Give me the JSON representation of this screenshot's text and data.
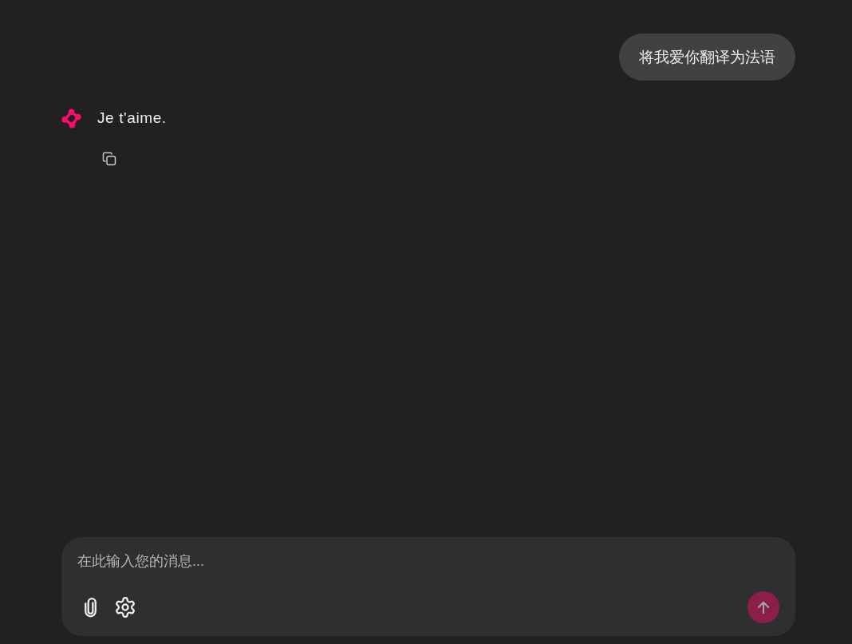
{
  "messages": [
    {
      "kind": "user",
      "text": "将我爱你翻译为法语"
    },
    {
      "kind": "assistant",
      "text": "Je t'aime."
    }
  ],
  "composer": {
    "placeholder": "在此输入您的消息...",
    "send_button": {
      "disabled": true
    }
  }
}
